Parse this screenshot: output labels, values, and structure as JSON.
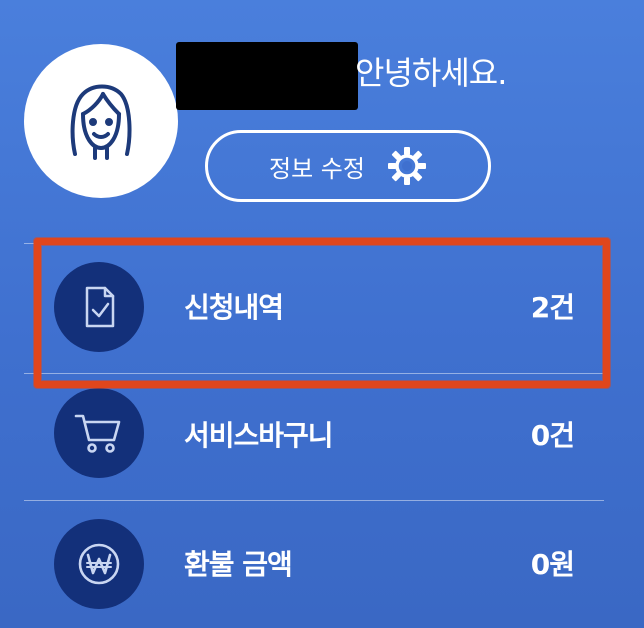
{
  "profile": {
    "greeting": "안녕하세요.",
    "edit_button_label": "정보 수정"
  },
  "menu": {
    "items": [
      {
        "label": "신청내역",
        "count": "2건",
        "icon": "document-check-icon"
      },
      {
        "label": "서비스바구니",
        "count": "0건",
        "icon": "shopping-cart-icon"
      },
      {
        "label": "환불 금액",
        "count": "0원",
        "icon": "won-currency-icon"
      }
    ]
  },
  "colors": {
    "background": "#4a7fdc",
    "icon_circle": "#13307a",
    "highlight": "#e0461c"
  }
}
